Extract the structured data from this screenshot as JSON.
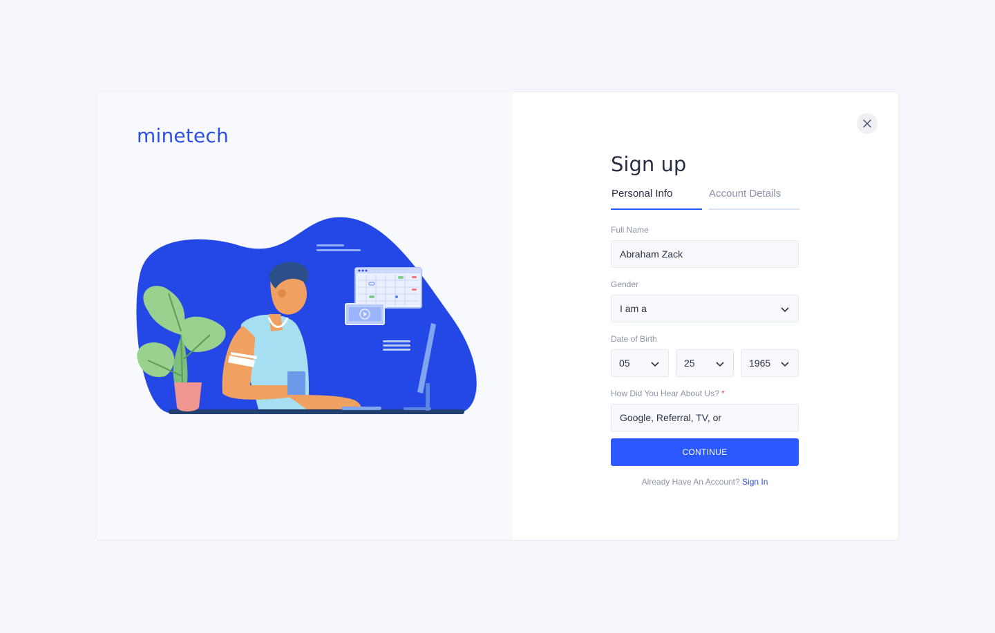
{
  "brand": {
    "logo_text": "minetech",
    "accent_color": "#2b59ff"
  },
  "header": {
    "title": "Sign up",
    "close_icon": "close-icon"
  },
  "tabs": [
    {
      "label": "Personal Info",
      "active": true
    },
    {
      "label": "Account Details",
      "active": false
    }
  ],
  "form": {
    "full_name": {
      "label": "Full Name",
      "value": "Abraham Zack"
    },
    "gender": {
      "label": "Gender",
      "value": "I am a"
    },
    "dob": {
      "label": "Date of Birth",
      "month": "05",
      "day": "25",
      "year": "1965"
    },
    "referral": {
      "label": "How Did You Hear About Us?",
      "required_mark": "*",
      "value": "Google, Referral, TV, or"
    },
    "continue_label": "CONTINUE"
  },
  "footer": {
    "prompt": "Already Have An Account?",
    "link": "Sign In"
  }
}
